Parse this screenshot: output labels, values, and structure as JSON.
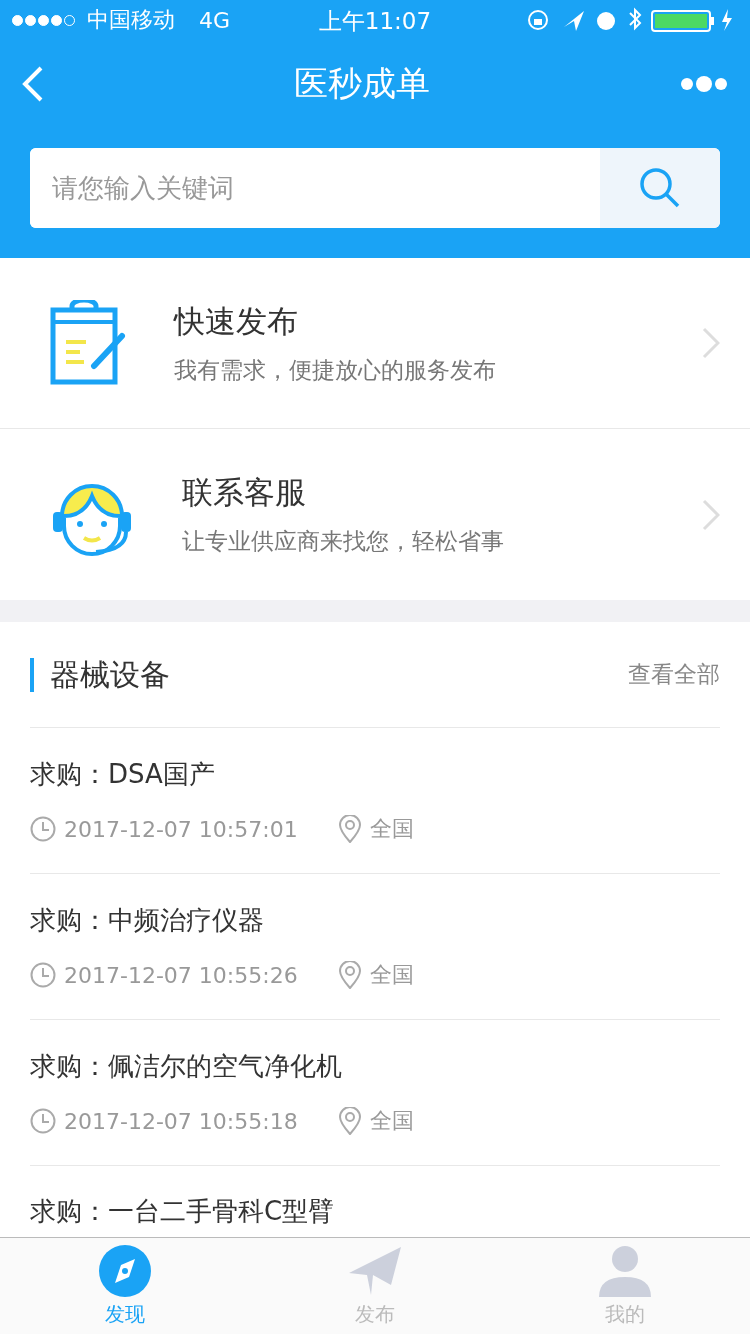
{
  "status_bar": {
    "carrier": "中国移动",
    "network": "4G",
    "time": "上午11:07"
  },
  "nav": {
    "title": "医秒成单"
  },
  "search": {
    "placeholder": "请您输入关键词"
  },
  "entries": [
    {
      "kind": "publish",
      "title": "快速发布",
      "subtitle": "我有需求，便捷放心的服务发布"
    },
    {
      "kind": "service",
      "title": "联系客服",
      "subtitle": "让专业供应商来找您，轻松省事"
    }
  ],
  "section": {
    "title": "器械设备",
    "more": "查看全部"
  },
  "requests": [
    {
      "title": "求购：DSA国产",
      "time": "2017-12-07 10:57:01",
      "region": "全国"
    },
    {
      "title": "求购：中频治疗仪器",
      "time": "2017-12-07 10:55:26",
      "region": "全国"
    },
    {
      "title": "求购：佩洁尔的空气净化机",
      "time": "2017-12-07 10:55:18",
      "region": "全国"
    },
    {
      "title": "求购：一台二手骨科C型臂"
    }
  ],
  "tabs": [
    {
      "kind": "discover",
      "label": "发现",
      "selected": true
    },
    {
      "kind": "publish",
      "label": "发布",
      "selected": false
    },
    {
      "kind": "mine",
      "label": "我的",
      "selected": false
    }
  ]
}
